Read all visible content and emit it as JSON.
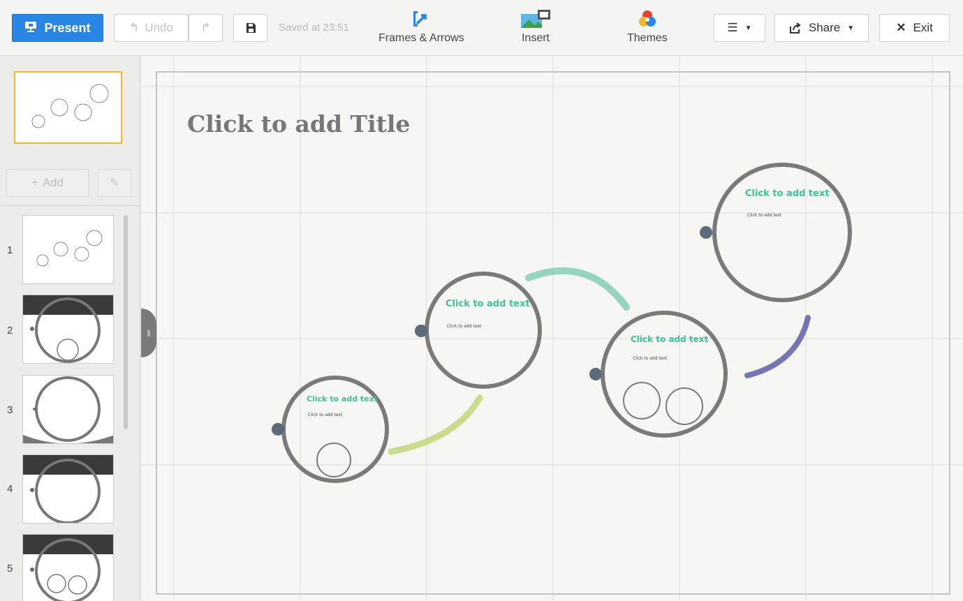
{
  "toolbar": {
    "present_label": "Present",
    "undo_label": "Undo",
    "saved_text": "Saved at 23:51",
    "frames_label": "Frames & Arrows",
    "insert_label": "Insert",
    "themes_label": "Themes",
    "share_label": "Share",
    "exit_label": "Exit"
  },
  "sidebar": {
    "add_label": "Add",
    "slides": [
      {
        "num": "1"
      },
      {
        "num": "2"
      },
      {
        "num": "3"
      },
      {
        "num": "4"
      },
      {
        "num": "5"
      }
    ]
  },
  "canvas": {
    "title": "Click to add Title",
    "frames": [
      {
        "title": "Click to add text",
        "body": "Click to add text"
      },
      {
        "title": "Click to add text",
        "body": "Click to add text"
      },
      {
        "title": "Click to add text",
        "body": "Click to add text"
      },
      {
        "title": "Click to add text",
        "body": "Click to add text"
      }
    ]
  },
  "colors": {
    "accent": "#2a86e4",
    "selection": "#f2b72e",
    "frame_text": "#3fbf9a",
    "frame_ring": "#7a7a7a"
  },
  "icons": [
    "present-icon",
    "undo-icon",
    "redo-icon",
    "save-icon",
    "frames-arrows-icon",
    "insert-icon",
    "themes-icon",
    "menu-icon",
    "share-icon",
    "close-icon",
    "plus-icon",
    "pencil-icon"
  ]
}
